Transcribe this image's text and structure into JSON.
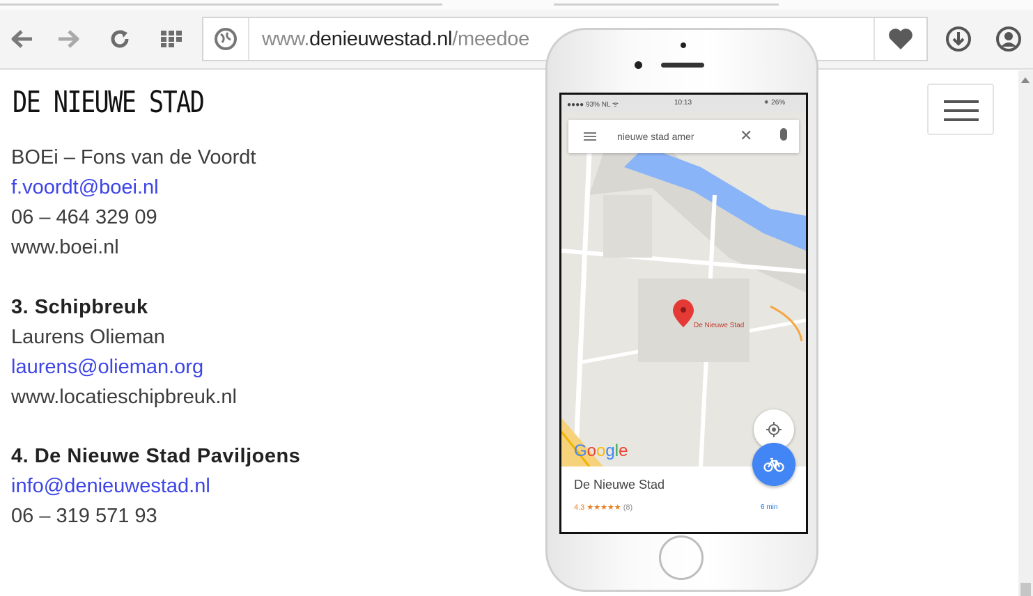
{
  "browser": {
    "url_host": "www.",
    "url_domain": "denieuwestad.nl",
    "url_path": "/meedoe"
  },
  "page": {
    "brand": "DE NIEUWE STAD",
    "lines": [
      {
        "text": "BOEi – Fons van de Voordt",
        "type": "text"
      },
      {
        "text": "f.voordt@boei.nl",
        "type": "link"
      },
      {
        "text": "06 – 464 329 09",
        "type": "text"
      },
      {
        "text": "www.boei.nl",
        "type": "text"
      },
      {
        "text": "3. Schipbreuk",
        "type": "head"
      },
      {
        "text": "Laurens Olieman",
        "type": "text"
      },
      {
        "text": "laurens@olieman.org",
        "type": "link"
      },
      {
        "text": "www.locatieschipbreuk.nl",
        "type": "text"
      },
      {
        "text": "4. De Nieuwe Stad Paviljoens",
        "type": "head"
      },
      {
        "text": "info@denieuwestad.nl",
        "type": "link"
      },
      {
        "text": "06 – 319 571 93",
        "type": "text"
      }
    ]
  },
  "phone": {
    "status": {
      "carrier": "●●●● 93% NL ᯤ",
      "time": "10:13",
      "battery": "⁕ 26%"
    },
    "search_query": "nieuwe stad amer",
    "pin_label": "De Nieuwe Stad",
    "place_name": "De Nieuwe Stad",
    "rating_value": "4.3",
    "rating_stars": "★★★★★",
    "rating_count": "(8)",
    "travel_time": "6 min",
    "google_logo": [
      "G",
      "o",
      "o",
      "g",
      "l",
      "e"
    ]
  },
  "colors": {
    "link": "#3d45e6",
    "fab": "#4285f4",
    "pin": "#e53935",
    "river": "#8ab4f8"
  }
}
